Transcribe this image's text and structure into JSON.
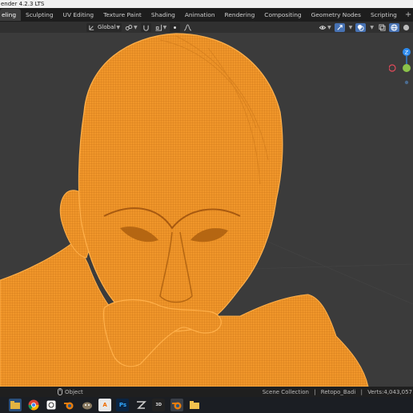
{
  "window": {
    "title": "ender 4.2.3 LTS"
  },
  "workspace_tabs": [
    {
      "label": "eling",
      "active": true
    },
    {
      "label": "Sculpting"
    },
    {
      "label": "UV Editing"
    },
    {
      "label": "Texture Paint"
    },
    {
      "label": "Shading"
    },
    {
      "label": "Animation"
    },
    {
      "label": "Rendering"
    },
    {
      "label": "Compositing"
    },
    {
      "label": "Geometry Nodes"
    },
    {
      "label": "Scripting"
    }
  ],
  "viewport_header": {
    "orientation_label": "Global",
    "accent_color": "#4772b3"
  },
  "viewport": {
    "mesh_color": "#f0962a",
    "background": "#3b3b3b",
    "gizmo_axes": [
      {
        "label": "Z",
        "color": "#2e8cf0"
      },
      {
        "label": "Y",
        "color": "#8bc34a"
      },
      {
        "label": "X",
        "color": "#e24a5a"
      }
    ]
  },
  "statusbar": {
    "mode_label": "Object",
    "collection": "Scene Collection",
    "object": "Retopo_Badi",
    "verts": "Verts:4,043,057"
  },
  "taskbar": {
    "apps": [
      {
        "name": "file-explorer-icon",
        "active": false
      },
      {
        "name": "chrome-icon",
        "active": false
      },
      {
        "name": "photo-viewer-icon",
        "active": false
      },
      {
        "name": "blender-icon",
        "active": false
      },
      {
        "name": "gimp-icon",
        "active": false
      },
      {
        "name": "autodesk-icon",
        "active": false
      },
      {
        "name": "photoshop-icon",
        "active": false
      },
      {
        "name": "zbrush-icon",
        "active": false
      },
      {
        "name": "photoscan-icon",
        "active": false
      },
      {
        "name": "blender-active-icon",
        "active": true
      },
      {
        "name": "folder-icon",
        "active": false
      }
    ]
  }
}
